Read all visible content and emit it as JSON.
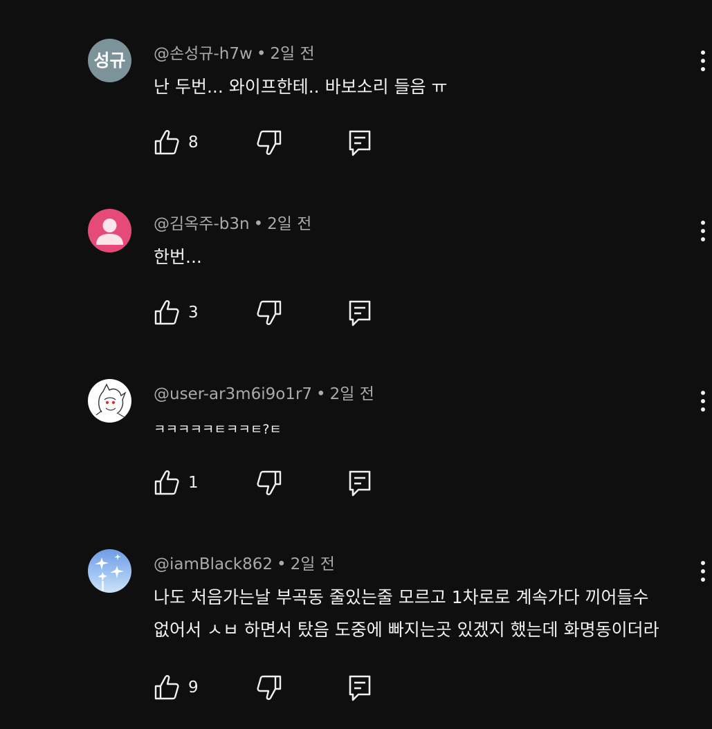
{
  "comments": [
    {
      "author": "@손성규-h7w",
      "time": "2일 전",
      "avatar_initials": "성규",
      "lines": [
        "난 두번... 와이프한테.. 바보소리 들음 ㅠ"
      ],
      "likes": "8"
    },
    {
      "author": "@김옥주-b3n",
      "time": "2일 전",
      "lines": [
        "한번..."
      ],
      "likes": "3"
    },
    {
      "author": "@user-ar3m6i9o1r7",
      "time": "2일 전",
      "lines": [
        "ㅋㅋㅋㅋㅋㅌㅋㅋㅌ?ㅌ"
      ],
      "likes": "1"
    },
    {
      "author": "@iamBlack862",
      "time": "2일 전",
      "lines": [
        "나도 처음가는날 부곡동 줄있는줄 모르고 1차로로 계속가다 끼어들수",
        "없어서 ㅅㅂ 하면서 탔음 도중에 빠지는곳 있겠지 했는데 화명동이더라"
      ],
      "likes": "9"
    }
  ],
  "icons": {
    "like": "thumbs-up-icon",
    "dislike": "thumbs-down-icon",
    "reply": "reply-comment-icon",
    "more": "more-vert-icon"
  },
  "colors": {
    "background": "#0f0f0f",
    "text_primary": "#f1f1f1",
    "text_secondary": "#aaaaaa",
    "avatar_initials_bg": "#7d939a",
    "avatar_default_bg": "#e64a78"
  }
}
